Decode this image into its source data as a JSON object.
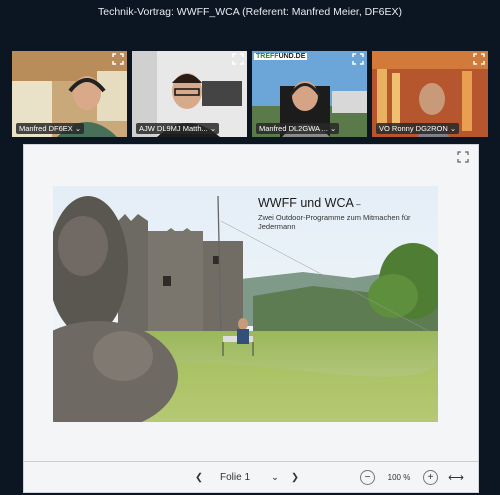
{
  "header": {
    "title": "Technik-Vortrag: WWFF_WCA (Referent: Manfred Meier, DF6EX)"
  },
  "participants": [
    {
      "name": "Manfred DF6EX ⌄"
    },
    {
      "name": "AJW DL9MJ Matth... ⌄"
    },
    {
      "name": "Manfred DL2GWA ... ⌄"
    },
    {
      "name": "VO Ronny DG2RON ⌄"
    }
  ],
  "tile_logo": {
    "prefix": "TREFF",
    "suffix": "UND.DE"
  },
  "slide": {
    "title": "WWFF und WCA",
    "title_suffix": " –",
    "subtitle": "Zwei Outdoor-Programme zum Mitmachen für Jedermann"
  },
  "toolbar": {
    "prev": "❮",
    "page_label": "Folie 1",
    "dropdown": "⌄",
    "next": "❯",
    "zoom_out": "−",
    "zoom_value": "100 %",
    "zoom_in": "+",
    "fit": "⟷"
  },
  "icons": {
    "expand": "expand-icon"
  }
}
